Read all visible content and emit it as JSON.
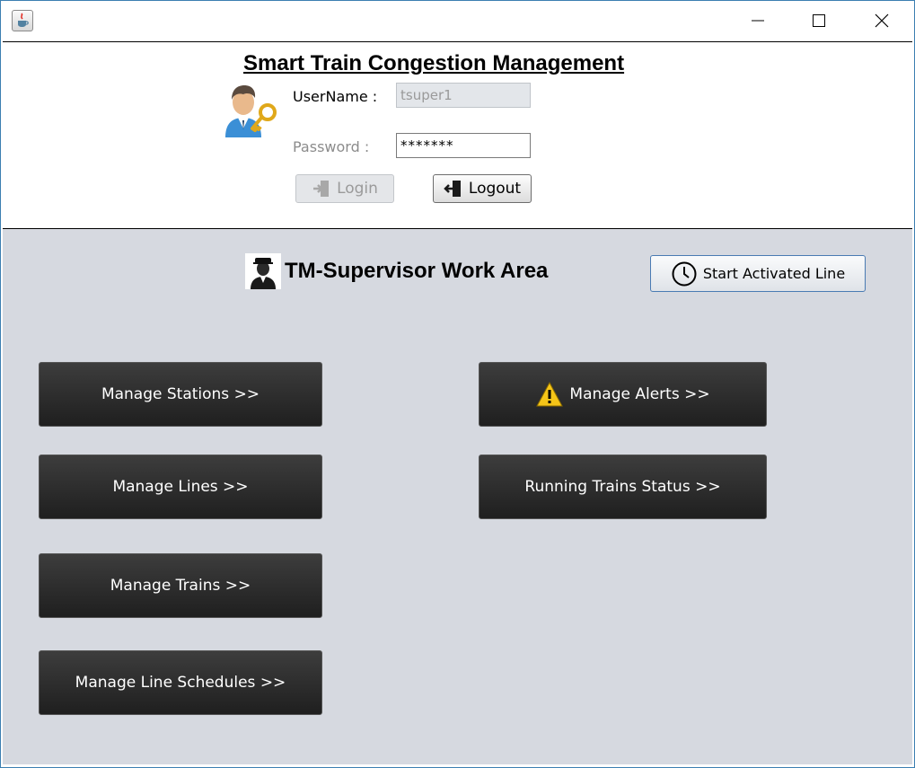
{
  "titlebar": {
    "icons": {
      "app": "java-cup-icon",
      "minimize": "minimize-icon",
      "maximize": "maximize-icon",
      "close": "close-icon"
    }
  },
  "login": {
    "title": "Smart Train Congestion Management",
    "username_label": "UserName :",
    "username_value": "tsuper1",
    "password_label": "Password :",
    "password_value": "*******",
    "login_button": "Login",
    "logout_button": "Logout"
  },
  "work_area": {
    "title": "TM-Supervisor Work Area",
    "start_button": "Start Activated Line",
    "buttons": {
      "stations": "Manage Stations >>",
      "lines": "Manage Lines >>",
      "trains": "Manage Trains >>",
      "schedules": "Manage Line Schedules >>",
      "alerts": "Manage Alerts >>",
      "running": "Running Trains Status >>"
    }
  },
  "colors": {
    "work_bg": "#d6d9e0",
    "dark_button": "#2b2b2b",
    "accent_border": "#4a7bb3"
  }
}
